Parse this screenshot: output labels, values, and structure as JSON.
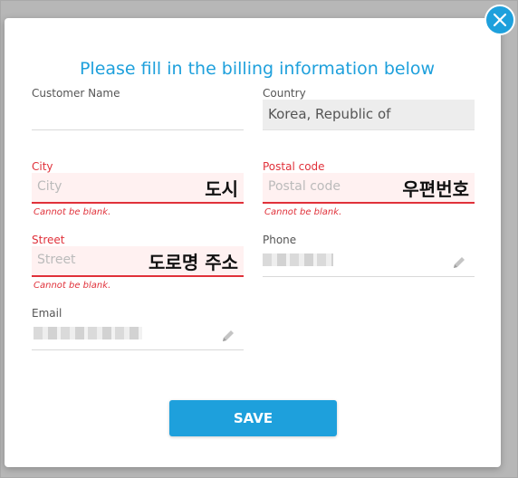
{
  "dialog": {
    "title": "Please fill in the billing information below",
    "save_label": "SAVE"
  },
  "fields": {
    "customer_name": {
      "label": "Customer Name",
      "value": ""
    },
    "country": {
      "label": "Country",
      "value": "Korea, Republic of"
    },
    "city": {
      "label": "City",
      "placeholder": "City",
      "error": "Cannot be blank.",
      "overlay": "도시"
    },
    "postal_code": {
      "label": "Postal code",
      "placeholder": "Postal code",
      "error": "Cannot be blank.",
      "overlay": "우편번호"
    },
    "street": {
      "label": "Street",
      "placeholder": "Street",
      "error": "Cannot be blank.",
      "overlay": "도로명 주소"
    },
    "phone": {
      "label": "Phone"
    },
    "email": {
      "label": "Email"
    }
  },
  "icons": {
    "close": "close-icon",
    "edit": "pencil-icon"
  },
  "colors": {
    "accent": "#1ea0dc",
    "error": "#e0313a"
  }
}
